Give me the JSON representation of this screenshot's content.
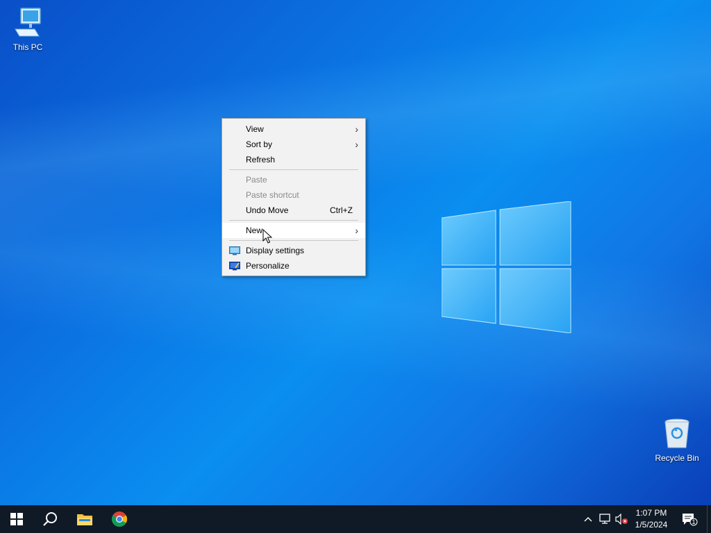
{
  "desktop": {
    "icons": [
      {
        "label": "This PC",
        "icon": "computer-icon"
      },
      {
        "label": "Recycle Bin",
        "icon": "recycle-bin-icon"
      }
    ]
  },
  "context_menu": {
    "items": [
      {
        "label": "View",
        "submenu": true,
        "enabled": true
      },
      {
        "label": "Sort by",
        "submenu": true,
        "enabled": true
      },
      {
        "label": "Refresh",
        "enabled": true
      },
      {
        "label": "Paste",
        "enabled": false
      },
      {
        "label": "Paste shortcut",
        "enabled": false
      },
      {
        "label": "Undo Move",
        "shortcut": "Ctrl+Z",
        "enabled": true
      },
      {
        "label": "New",
        "submenu": true,
        "enabled": true,
        "highlighted": true
      },
      {
        "label": "Display settings",
        "icon": "display-settings-icon",
        "enabled": true
      },
      {
        "label": "Personalize",
        "icon": "personalize-icon",
        "enabled": true
      }
    ]
  },
  "taskbar": {
    "buttons": [
      "start-icon",
      "search-icon",
      "file-explorer-icon",
      "chrome-icon"
    ],
    "clock": {
      "time": "1:07 PM",
      "date": "1/5/2024"
    },
    "notifications": {
      "count": "1"
    }
  },
  "colors": {
    "taskbar": "#101a26",
    "menu_background": "#f2f2f2",
    "desktop_accent": "#0b6fe0"
  }
}
